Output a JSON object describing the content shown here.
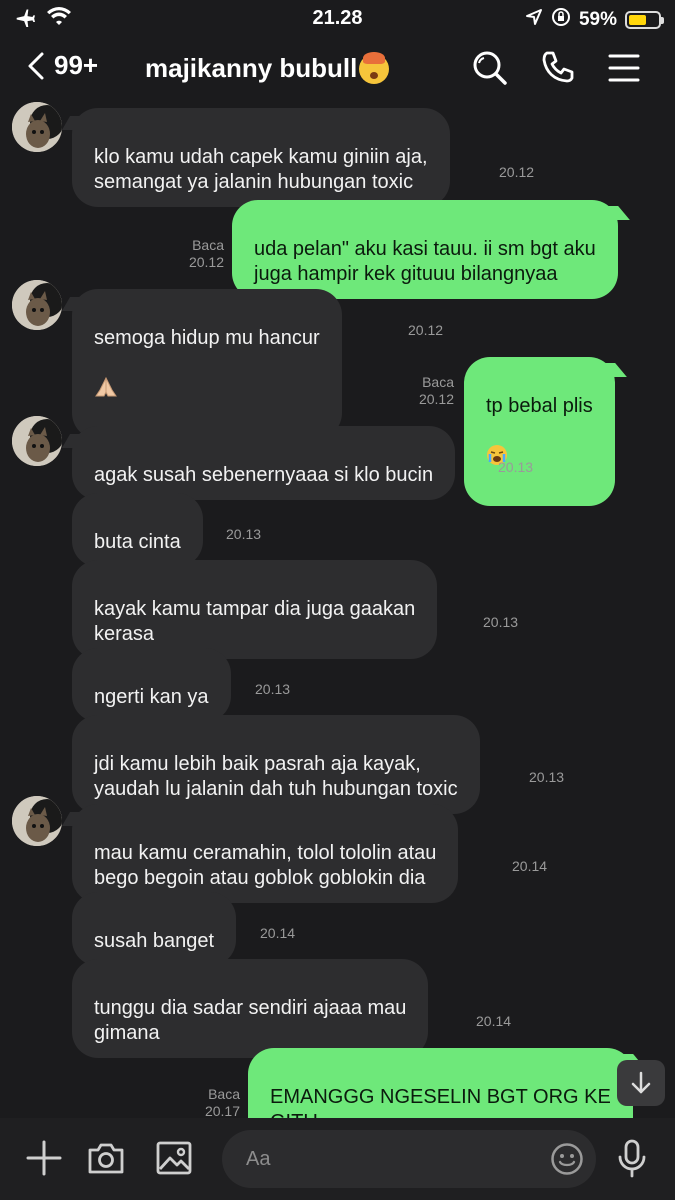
{
  "status": {
    "time": "21.28",
    "battery": "59%",
    "battery_level": 0.59,
    "icons": [
      "airplane-icon",
      "wifi-icon",
      "location-icon",
      "rotation-lock-icon",
      "battery-icon"
    ]
  },
  "header": {
    "back_count": "99+",
    "title": "majikanny bubull",
    "title_emoji": "exploding-head-emoji",
    "icons": [
      "chevron-left-icon",
      "search-icon",
      "phone-icon",
      "menu-icon"
    ]
  },
  "messages": [
    {
      "dir": "in",
      "text": "klo kamu udah capek kamu giniin aja,\nsemangat ya jalanin hubungan toxic",
      "time": "20.12",
      "avatar": true
    },
    {
      "dir": "out",
      "text": "uda pelan\" aku kasi tauu. ii sm bgt aku\njuga hampir kek gituuu bilangnyaa",
      "time": "20.12",
      "read": "Baca"
    },
    {
      "dir": "in",
      "text": "semoga hidup mu hancur",
      "emoji": "praying-hands-emoji",
      "time": "20.12",
      "avatar": true
    },
    {
      "dir": "out",
      "text": "tp bebal plis",
      "emoji": "crying-face-emoji",
      "time": "20.12",
      "read": "Baca"
    },
    {
      "dir": "in",
      "text": "agak susah sebenernyaaa si klo bucin",
      "time": "20.13",
      "avatar": true
    },
    {
      "dir": "in",
      "text": "buta cinta",
      "time": "20.13"
    },
    {
      "dir": "in",
      "text": "kayak kamu tampar dia juga gaakan\nkerasa",
      "time": "20.13"
    },
    {
      "dir": "in",
      "text": "ngerti kan ya",
      "time": "20.13"
    },
    {
      "dir": "in",
      "text": "jdi kamu lebih baik pasrah aja kayak,\nyaudah lu jalanin dah tuh hubungan toxic",
      "time": "20.13"
    },
    {
      "dir": "in",
      "text": "mau kamu ceramahin, tolol tololin atau\nbego begoin atau goblok goblokin dia",
      "time": "20.14",
      "avatar": true
    },
    {
      "dir": "in",
      "text": "susah banget",
      "time": "20.14"
    },
    {
      "dir": "in",
      "text": "tunggu dia sadar sendiri ajaaa mau\ngimana",
      "time": "20.14"
    },
    {
      "dir": "out",
      "text": "EMANGGG NGESELIN BGT ORG KE\nGITU",
      "time": "20.17",
      "read": "Baca"
    }
  ],
  "composer": {
    "placeholder": "Aa",
    "icons": [
      "plus-icon",
      "camera-icon",
      "image-icon",
      "emoji-icon",
      "microphone-icon"
    ]
  },
  "scroll_button": "arrow-down-icon",
  "colors": {
    "background": "#1b1b1d",
    "incoming_bubble": "#2d2d2f",
    "outgoing_bubble": "#6ee87a",
    "battery": "#ffd60a"
  }
}
